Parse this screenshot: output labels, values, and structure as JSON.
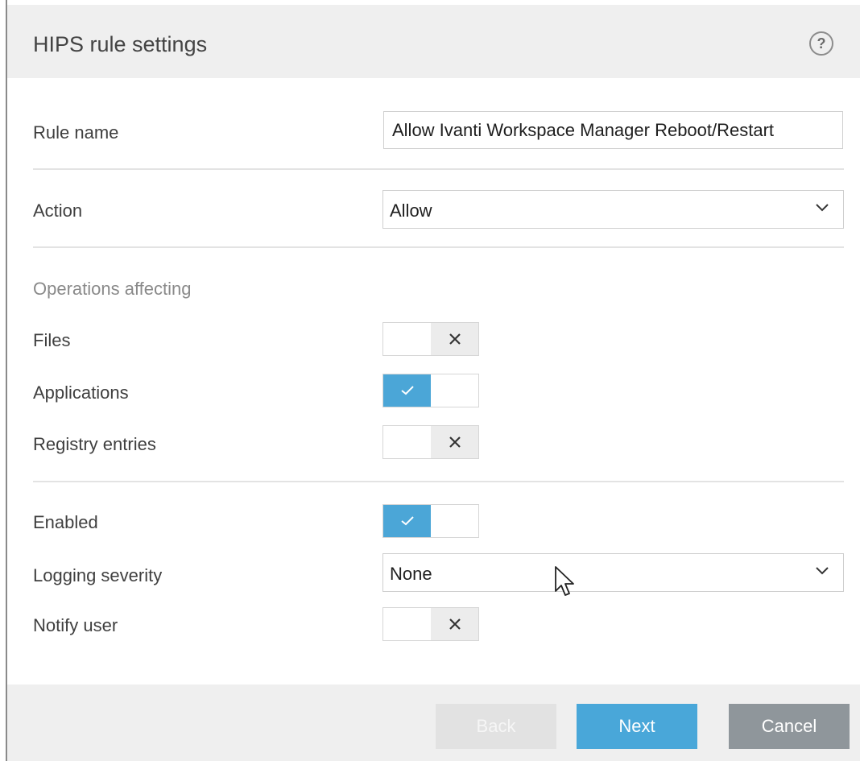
{
  "header": {
    "title": "HIPS rule settings",
    "help_icon": "question-mark-icon"
  },
  "fields": {
    "rule_name": {
      "label": "Rule name",
      "value": "Allow Ivanti Workspace Manager Reboot/Restart"
    },
    "action": {
      "label": "Action",
      "value": "Allow"
    },
    "operations_section": "Operations affecting",
    "files": {
      "label": "Files",
      "enabled": false
    },
    "applications": {
      "label": "Applications",
      "enabled": true
    },
    "registry": {
      "label": "Registry entries",
      "enabled": false
    },
    "enabled": {
      "label": "Enabled",
      "enabled": true
    },
    "logging": {
      "label": "Logging severity",
      "value": "None"
    },
    "notify": {
      "label": "Notify user",
      "enabled": false
    }
  },
  "footer": {
    "back_label": "Back",
    "next_label": "Next",
    "cancel_label": "Cancel"
  },
  "colors": {
    "toggle_on": "#4ba6d7",
    "next_button": "#49a7d9",
    "cancel_button": "#8f969b",
    "back_button_disabled": "#e2e2e2"
  }
}
